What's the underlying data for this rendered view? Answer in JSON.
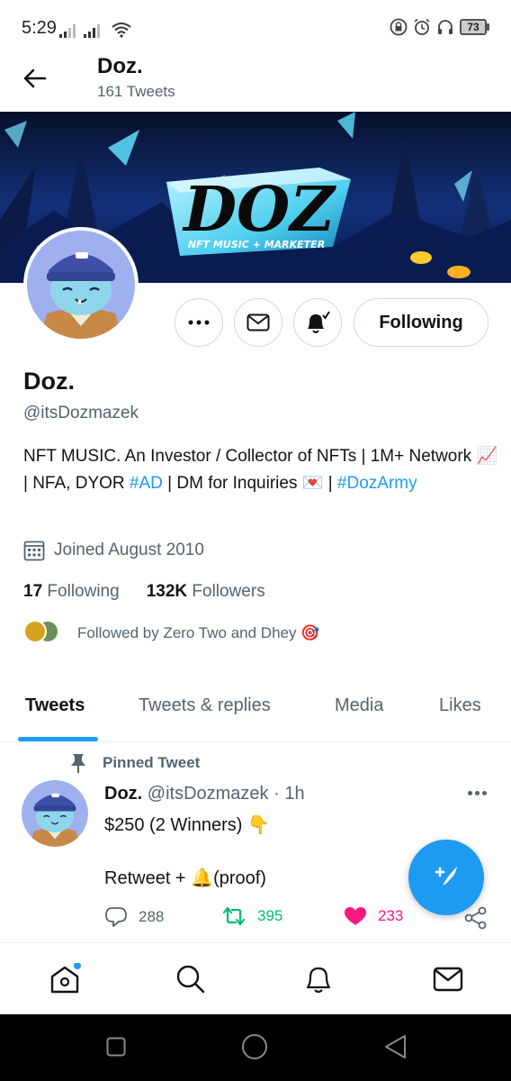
{
  "status_bar": {
    "time": "5:29",
    "battery": "73"
  },
  "header": {
    "title": "Doz.",
    "subtitle": "161 Tweets"
  },
  "banner": {
    "logo_text": "DOZ",
    "tagline": "NFT MUSIC + MARKETER"
  },
  "actions": {
    "following_label": "Following"
  },
  "profile": {
    "name": "Doz.",
    "handle": "@itsDozmazek",
    "bio_part1": "NFT MUSIC.  An Investor / Collector of NFTs | 1M+ Network ",
    "bio_emoji1": "📈",
    "bio_part2": " | NFA, DYOR ",
    "bio_hashtag1": "#AD",
    "bio_part3": " | DM for Inquiries ",
    "bio_emoji2": "💌",
    "bio_part4": " | ",
    "bio_hashtag2": "#DozArmy",
    "joined": "Joined August 2010",
    "following_count": "17",
    "following_label": "Following",
    "followers_count": "132K",
    "followers_label": "Followers",
    "followed_by": "Followed by Zero Two and Dhey 🎯"
  },
  "tabs": [
    {
      "label": "Tweets",
      "active": true
    },
    {
      "label": "Tweets & replies",
      "active": false
    },
    {
      "label": "Media",
      "active": false
    },
    {
      "label": "Likes",
      "active": false
    }
  ],
  "tweet": {
    "pinned_label": "Pinned Tweet",
    "author_name": "Doz.",
    "author_meta": " @itsDozmazek · 1h",
    "line1": "$250 (2 Winners) 👇",
    "line2": "Retweet + 🔔(proof)",
    "replies": "288",
    "retweets": "395",
    "likes": "233"
  },
  "colors": {
    "accent": "#1d9bf0",
    "retweet": "#00ba7c",
    "like": "#f91880",
    "secondary_text": "#536471"
  },
  "icons": {
    "back": "arrow-left-icon",
    "more": "more-dots-icon",
    "message": "envelope-icon",
    "notify": "bell-check-icon",
    "calendar": "calendar-icon",
    "pin": "pin-icon",
    "reply": "reply-icon",
    "retweet": "retweet-icon",
    "like": "heart-icon",
    "share": "share-icon",
    "compose": "compose-icon",
    "home": "home-icon",
    "search": "search-icon",
    "notifications": "bell-icon",
    "messages": "envelope-icon"
  }
}
